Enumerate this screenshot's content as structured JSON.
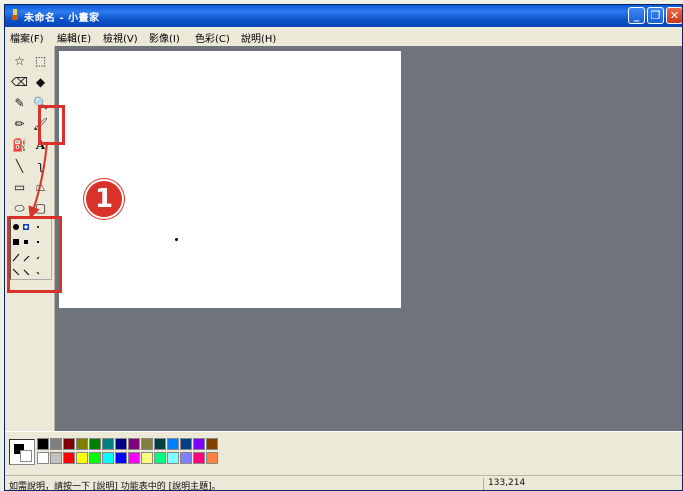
{
  "titlebar": {
    "title": "未命名 - 小畫家",
    "min_glyph": "_",
    "max_glyph": "❐",
    "close_glyph": "✕"
  },
  "menu": {
    "items": [
      "檔案(F)",
      "編輯(E)",
      "檢視(V)",
      "影像(I)",
      "色彩(C)",
      "說明(H)"
    ]
  },
  "toolbox": {
    "tools": [
      {
        "name": "free-form-select-icon",
        "glyph": "☆"
      },
      {
        "name": "rect-select-icon",
        "glyph": "⬚"
      },
      {
        "name": "eraser-icon",
        "glyph": "⌫"
      },
      {
        "name": "fill-icon",
        "glyph": "◆"
      },
      {
        "name": "pick-color-icon",
        "glyph": "✎"
      },
      {
        "name": "magnifier-icon",
        "glyph": "🔍"
      },
      {
        "name": "pencil-icon",
        "glyph": "✏"
      },
      {
        "name": "brush-icon",
        "glyph": "🖌"
      },
      {
        "name": "airbrush-icon",
        "glyph": "⛽"
      },
      {
        "name": "text-icon",
        "glyph": "A"
      },
      {
        "name": "line-icon",
        "glyph": "╲"
      },
      {
        "name": "curve-icon",
        "glyph": "ʅ"
      },
      {
        "name": "rectangle-icon",
        "glyph": "▭"
      },
      {
        "name": "polygon-icon",
        "glyph": "⏢"
      },
      {
        "name": "ellipse-icon",
        "glyph": "⬭"
      },
      {
        "name": "rounded-rect-icon",
        "glyph": "▢"
      }
    ]
  },
  "annotation": {
    "step_number": "1"
  },
  "palette": {
    "top_row": [
      "#000000",
      "#808080",
      "#800000",
      "#808000",
      "#008000",
      "#008080",
      "#000080",
      "#800080",
      "#808040",
      "#004040",
      "#0080ff",
      "#004080",
      "#8000ff",
      "#804000"
    ],
    "bottom_row": [
      "#ffffff",
      "#c0c0c0",
      "#ff0000",
      "#ffff00",
      "#00ff00",
      "#00ffff",
      "#0000ff",
      "#ff00ff",
      "#ffff80",
      "#00ff80",
      "#80ffff",
      "#8080ff",
      "#ff0080",
      "#ff8040"
    ]
  },
  "status": {
    "help_text": "如需說明，請按一下 [說明] 功能表中的 [說明主題]。",
    "coords": "133,214"
  }
}
